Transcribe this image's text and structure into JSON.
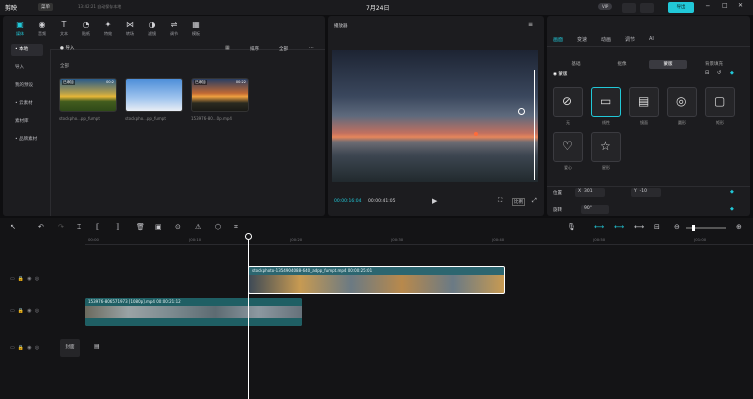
{
  "app": {
    "name": "剪映",
    "project": "7月24日",
    "menu_label": "菜单",
    "autosave": "13:42:21 自动保存本地",
    "export_label": "导出",
    "vip_label": "VIP"
  },
  "tools": [
    {
      "label": "媒体",
      "icon": "media-icon"
    },
    {
      "label": "音频",
      "icon": "audio-icon"
    },
    {
      "label": "文本",
      "icon": "text-icon"
    },
    {
      "label": "贴纸",
      "icon": "sticker-icon"
    },
    {
      "label": "特效",
      "icon": "effect-icon"
    },
    {
      "label": "转场",
      "icon": "transition-icon"
    },
    {
      "label": "滤镜",
      "icon": "filter-icon"
    },
    {
      "label": "调节",
      "icon": "adjust-icon"
    },
    {
      "label": "模板",
      "icon": "template-icon"
    }
  ],
  "sidebar": [
    {
      "label": "• 本地"
    },
    {
      "label": "导入"
    },
    {
      "label": "我的预设"
    },
    {
      "label": "• 云素材"
    },
    {
      "label": "素材库"
    },
    {
      "label": "• 品牌素材"
    }
  ],
  "media": {
    "import_label": "导入",
    "all_label": "全部",
    "sort_label": "排序",
    "filter_label": "全部",
    "items": [
      {
        "badge": "已添加",
        "duration": "00:2",
        "caption": "stockpho...pp_fumpt"
      },
      {
        "badge": "",
        "duration": "",
        "caption": "stockpho...pp_fumpt"
      },
      {
        "badge": "已添加",
        "duration": "00:22",
        "caption": "153976-80...0p.mp4"
      }
    ]
  },
  "player": {
    "title": "播放器",
    "current_time": "00:00:16:04",
    "total_time": "00:00:41:05",
    "ratio_label": "比例"
  },
  "props": {
    "tabs": [
      "画面",
      "变速",
      "动画",
      "调节",
      "AI"
    ],
    "subtabs": [
      "基础",
      "抠像",
      "蒙版",
      "背景填充"
    ],
    "mask_label": "蒙版",
    "masks": [
      "无",
      "线性",
      "镜面",
      "圆形",
      "矩形",
      "爱心",
      "星形"
    ],
    "pos_label": "位置",
    "x_label": "X",
    "x_value": "301",
    "y_label": "Y",
    "y_value": "-10",
    "rot_label": "旋转",
    "rot_value": "90°"
  },
  "timeline": {
    "ticks": [
      "00:00",
      "|00:10",
      "|00:20",
      "|00:30",
      "|00:40",
      "|00:50",
      "|01:00"
    ],
    "clip1": "stockphoto-1354904088-640_adpp_fumpt.mp4  00:00:25:01",
    "clip2": "153976-806571973 [1080p].mp4  00:00:21:12",
    "cover_label": "封面"
  },
  "colors": {
    "accent": "#21c8d8",
    "clip1": "#2c6670",
    "clip2": "#1f5f64"
  }
}
